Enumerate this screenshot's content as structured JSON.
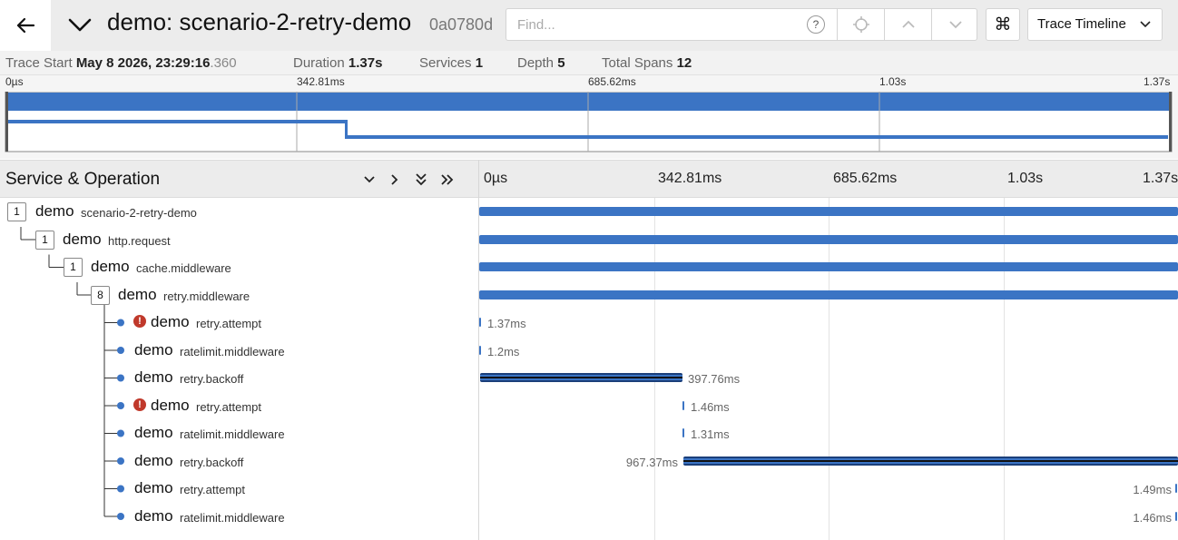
{
  "header": {
    "title": "demo: scenario-2-retry-demo",
    "trace_id": "0a0780d",
    "find_placeholder": "Find...",
    "find_help": "?",
    "view_label": "Trace Timeline"
  },
  "summary": {
    "trace_start_label": "Trace Start",
    "trace_start_value": "May 8 2026, 23:29:16",
    "trace_start_ms": ".360",
    "duration_label": "Duration",
    "duration_value": "1.37s",
    "services_label": "Services",
    "services_value": "1",
    "depth_label": "Depth",
    "depth_value": "5",
    "total_spans_label": "Total Spans",
    "total_spans_value": "12"
  },
  "minimap": {
    "ticks": [
      "0µs",
      "342.81ms",
      "685.62ms",
      "1.03s",
      "1.37s"
    ]
  },
  "timeline": {
    "section_title": "Service & Operation",
    "ticks": [
      "0µs",
      "342.81ms",
      "685.62ms",
      "1.03s",
      "1.37s"
    ]
  },
  "spans": [
    {
      "service": "demo",
      "operation": "scenario-2-retry-demo",
      "count": "1",
      "error": false,
      "duration": ""
    },
    {
      "service": "demo",
      "operation": "http.request",
      "count": "1",
      "error": false,
      "duration": ""
    },
    {
      "service": "demo",
      "operation": "cache.middleware",
      "count": "1",
      "error": false,
      "duration": ""
    },
    {
      "service": "demo",
      "operation": "retry.middleware",
      "count": "8",
      "error": false,
      "duration": ""
    },
    {
      "service": "demo",
      "operation": "retry.attempt",
      "count": "",
      "error": true,
      "duration": "1.37ms"
    },
    {
      "service": "demo",
      "operation": "ratelimit.middleware",
      "count": "",
      "error": false,
      "duration": "1.2ms"
    },
    {
      "service": "demo",
      "operation": "retry.backoff",
      "count": "",
      "error": false,
      "duration": "397.76ms"
    },
    {
      "service": "demo",
      "operation": "retry.attempt",
      "count": "",
      "error": true,
      "duration": "1.46ms"
    },
    {
      "service": "demo",
      "operation": "ratelimit.middleware",
      "count": "",
      "error": false,
      "duration": "1.31ms"
    },
    {
      "service": "demo",
      "operation": "retry.backoff",
      "count": "",
      "error": false,
      "duration": "967.37ms"
    },
    {
      "service": "demo",
      "operation": "retry.attempt",
      "count": "",
      "error": false,
      "duration": "1.49ms"
    },
    {
      "service": "demo",
      "operation": "ratelimit.middleware",
      "count": "",
      "error": false,
      "duration": "1.46ms"
    }
  ],
  "colors": {
    "span_bar": "#3b74c4",
    "error": "#c0392b"
  }
}
